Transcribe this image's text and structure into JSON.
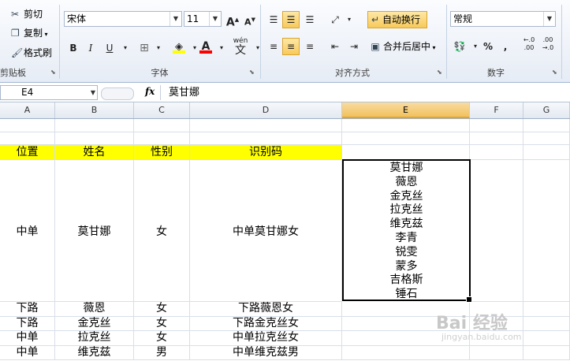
{
  "ribbon": {
    "clipboard": {
      "cut": "剪切",
      "copy": "复制",
      "format_painter": "格式刷",
      "group_label": "剪贴板"
    },
    "font": {
      "font_name": "宋体",
      "font_size": "11",
      "grow": "A",
      "shrink": "A",
      "bold": "B",
      "italic": "I",
      "underline": "U",
      "font_color_letter": "A",
      "wen": "wén",
      "wen_char": "文",
      "group_label": "字体",
      "fill_color": "#ffff00",
      "font_color": "#ff0000"
    },
    "alignment": {
      "wrap_text": "自动换行",
      "merge_center": "合并后居中",
      "group_label": "对齐方式"
    },
    "number": {
      "format": "常规",
      "percent": "%",
      "comma": ",",
      "inc_dec": "←.0\n.00",
      "dec_dec": ".00\n→.0",
      "group_label": "数字"
    }
  },
  "formula_bar": {
    "name_box": "E4",
    "fx": "fx",
    "content": "莫甘娜"
  },
  "columns": [
    "A",
    "B",
    "C",
    "D",
    "E",
    "F",
    "G"
  ],
  "header_row": [
    "位置",
    "姓名",
    "性别",
    "识别码"
  ],
  "row4": [
    "中单",
    "莫甘娜",
    "女",
    "中单莫甘娜女"
  ],
  "e4_lines": [
    "莫甘娜",
    "薇恩",
    "金克丝",
    "拉克丝",
    "维克兹",
    "李青",
    "锐雯",
    "蒙多",
    "吉格斯",
    "锤石"
  ],
  "rows": [
    [
      "下路",
      "薇恩",
      "女",
      "下路薇恩女"
    ],
    [
      "下路",
      "金克丝",
      "女",
      "下路金克丝女"
    ],
    [
      "中单",
      "拉克丝",
      "女",
      "中单拉克丝女"
    ],
    [
      "中单",
      "维克兹",
      "男",
      "中单维克兹男"
    ]
  ],
  "watermark": {
    "main": "Bai 经验",
    "sub": "jingyan.baidu.com"
  }
}
